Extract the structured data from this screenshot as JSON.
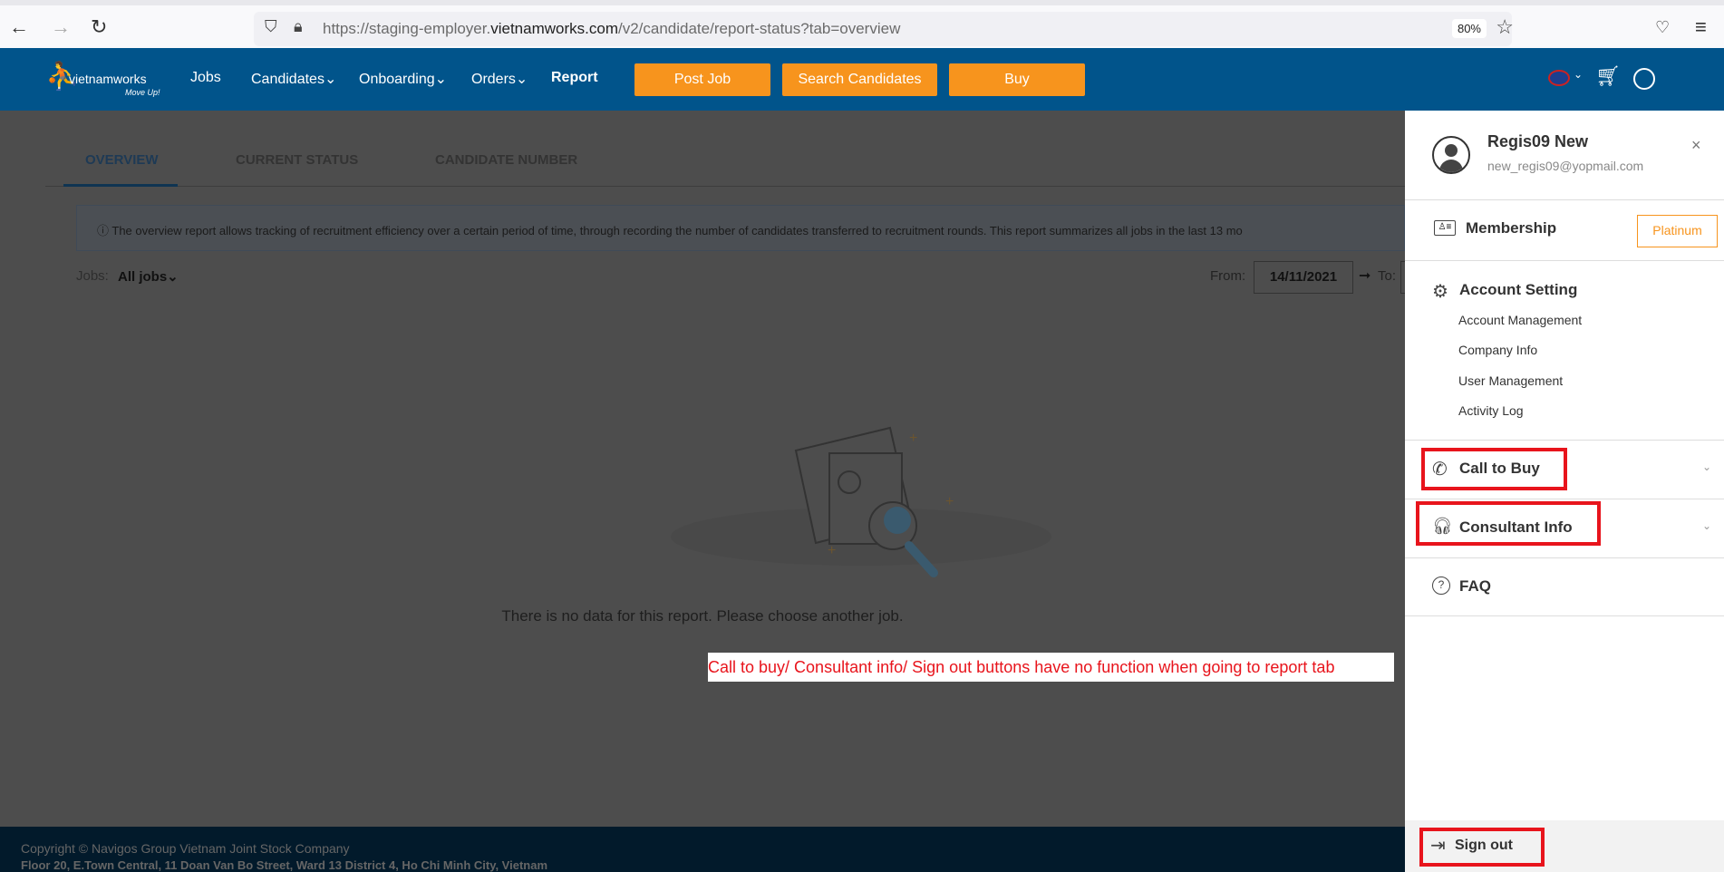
{
  "browser": {
    "url_prefix": "https://staging-employer.",
    "url_domain": "vietnamworks.com",
    "url_path": "/v2/candidate/report-status?tab=overview",
    "zoom": "80%"
  },
  "nav": {
    "logo": "vietnamworks",
    "logo_tagline": "Move Up!",
    "items": [
      "Jobs",
      "Candidates",
      "Onboarding",
      "Orders",
      "Report"
    ],
    "buttons": [
      "Post Job",
      "Search Candidates",
      "Buy"
    ]
  },
  "tabs": [
    "OVERVIEW",
    "CURRENT STATUS",
    "CANDIDATE NUMBER"
  ],
  "info": "The overview report allows tracking of recruitment efficiency over a certain period of time, through recording the number of candidates transferred to recruitment rounds. This report summarizes all jobs in the last 13 mo",
  "filters": {
    "jobs_label": "Jobs:",
    "jobs_value": "All jobs",
    "from_label": "From:",
    "from_value": "14/11/2021",
    "to_label": "To:"
  },
  "empty_message": "There is no data for this report. Please choose another job.",
  "annotation": "Call to buy/ Consultant info/ Sign out buttons have no function when going to report tab",
  "footer": {
    "copyright": "Copyright © Navigos Group Vietnam Joint Stock Company",
    "address": "Floor 20, E.Town Central, 11 Doan Van Bo Street, Ward 13 District 4, Ho Chi Minh City, Vietnam"
  },
  "panel": {
    "name": "Regis09 New",
    "email": "new_regis09@yopmail.com",
    "membership": "Membership",
    "membership_level": "Platinum",
    "account_setting": "Account Setting",
    "account_items": [
      "Account Management",
      "Company Info",
      "User Management",
      "Activity Log"
    ],
    "call_to_buy": "Call to Buy",
    "consultant_info": "Consultant Info",
    "faq": "FAQ",
    "sign_out": "Sign out"
  },
  "colors": {
    "brand": "#01548b",
    "accent": "#f7941d",
    "highlight": "#e8141c"
  }
}
